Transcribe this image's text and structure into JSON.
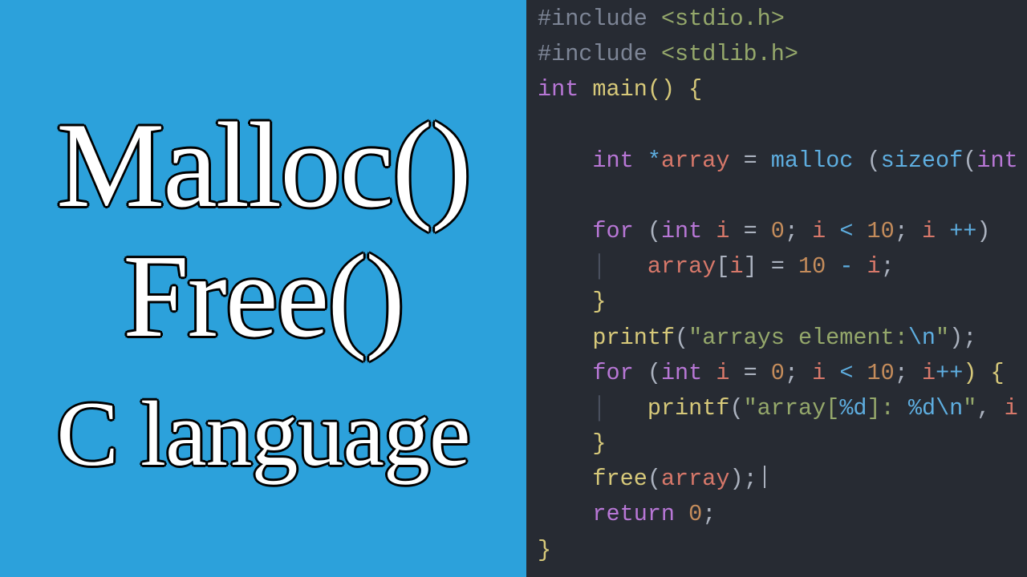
{
  "left": {
    "line1": "Malloc()",
    "line2": "Free()",
    "line3": "C language"
  },
  "code": {
    "l1": {
      "pre": "#include",
      "hdr": "<stdio.h>"
    },
    "l2": {
      "pre": "#include",
      "hdr": "<stdlib.h>"
    },
    "l3": {
      "kw": "int",
      "fn": "main",
      "p": "() {"
    },
    "l4": {
      "kw": "int",
      "star": "*",
      "id": "array",
      "eq": " = ",
      "mac1": "malloc",
      "sp": " ",
      "p1": "(",
      "mac2": "sizeof",
      "p2": "(",
      "t": "int"
    },
    "l5": {
      "kw1": "for",
      "p1": " (",
      "kw2": "int",
      "sp1": " ",
      "id1": "i",
      "eq": " = ",
      "n1": "0",
      "sc1": "; ",
      "id2": "i",
      "op1": " < ",
      "n2": "10",
      "sc2": "; ",
      "id3": "i",
      "sp2": " ",
      "op2": "++",
      "p2": ")"
    },
    "l6": {
      "id1": "array",
      "b1": "[",
      "id2": "i",
      "b2": "]",
      "eq": " = ",
      "n1": "10",
      "op": " - ",
      "id3": "i",
      "sc": ";"
    },
    "l7": {
      "brace": "}"
    },
    "l8": {
      "fn": "printf",
      "p1": "(",
      "str1": "\"arrays element:",
      "esc": "\\n",
      "str2": "\"",
      "p2": ");"
    },
    "l9": {
      "kw1": "for",
      "p1": " (",
      "kw2": "int",
      "sp1": " ",
      "id1": "i",
      "eq": " = ",
      "n1": "0",
      "sc1": "; ",
      "id2": "i",
      "op1": " < ",
      "n2": "10",
      "sc2": "; ",
      "id3": "i",
      "op2": "++",
      "p2": ") {"
    },
    "l10": {
      "fn": "printf",
      "p1": "(",
      "str1": "\"array[",
      "esc1": "%d",
      "str2": "]: ",
      "esc2": "%d",
      "esc3": "\\n",
      "str3": "\"",
      "p2": ", ",
      "id": "i"
    },
    "l11": {
      "brace": "}"
    },
    "l12": {
      "fn": "free",
      "p1": "(",
      "id": "array",
      "p2": ");"
    },
    "l13": {
      "kw": "return",
      "sp": " ",
      "n": "0",
      "sc": ";"
    },
    "l14": {
      "brace": "}"
    }
  }
}
